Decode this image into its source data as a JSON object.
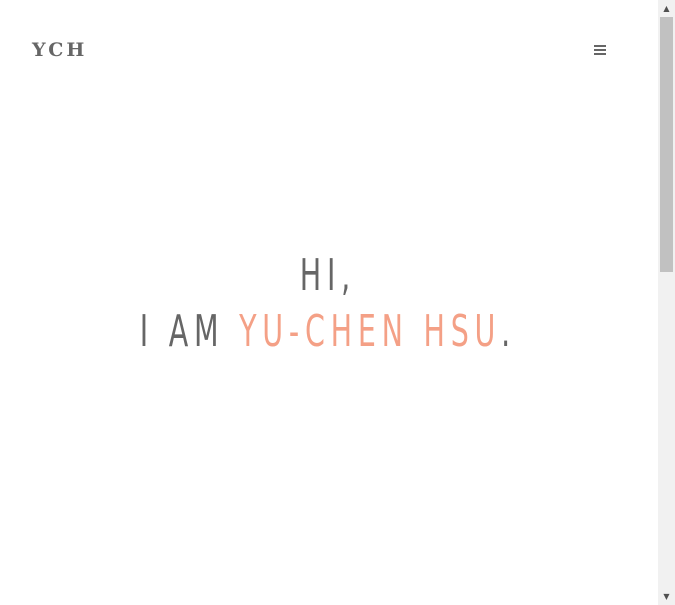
{
  "header": {
    "logo": "YCH",
    "menu_icon": "hamburger-menu-icon"
  },
  "hero": {
    "line1": "Hi,",
    "line2_prefix": "I am ",
    "name": "Yu-Chen Hsu",
    "line2_suffix": "."
  },
  "colors": {
    "text": "#666666",
    "accent": "#f4a086",
    "background": "#ffffff"
  },
  "scrollbar": {
    "up_icon": "scroll-up-arrow-icon",
    "down_icon": "scroll-down-arrow-icon"
  }
}
